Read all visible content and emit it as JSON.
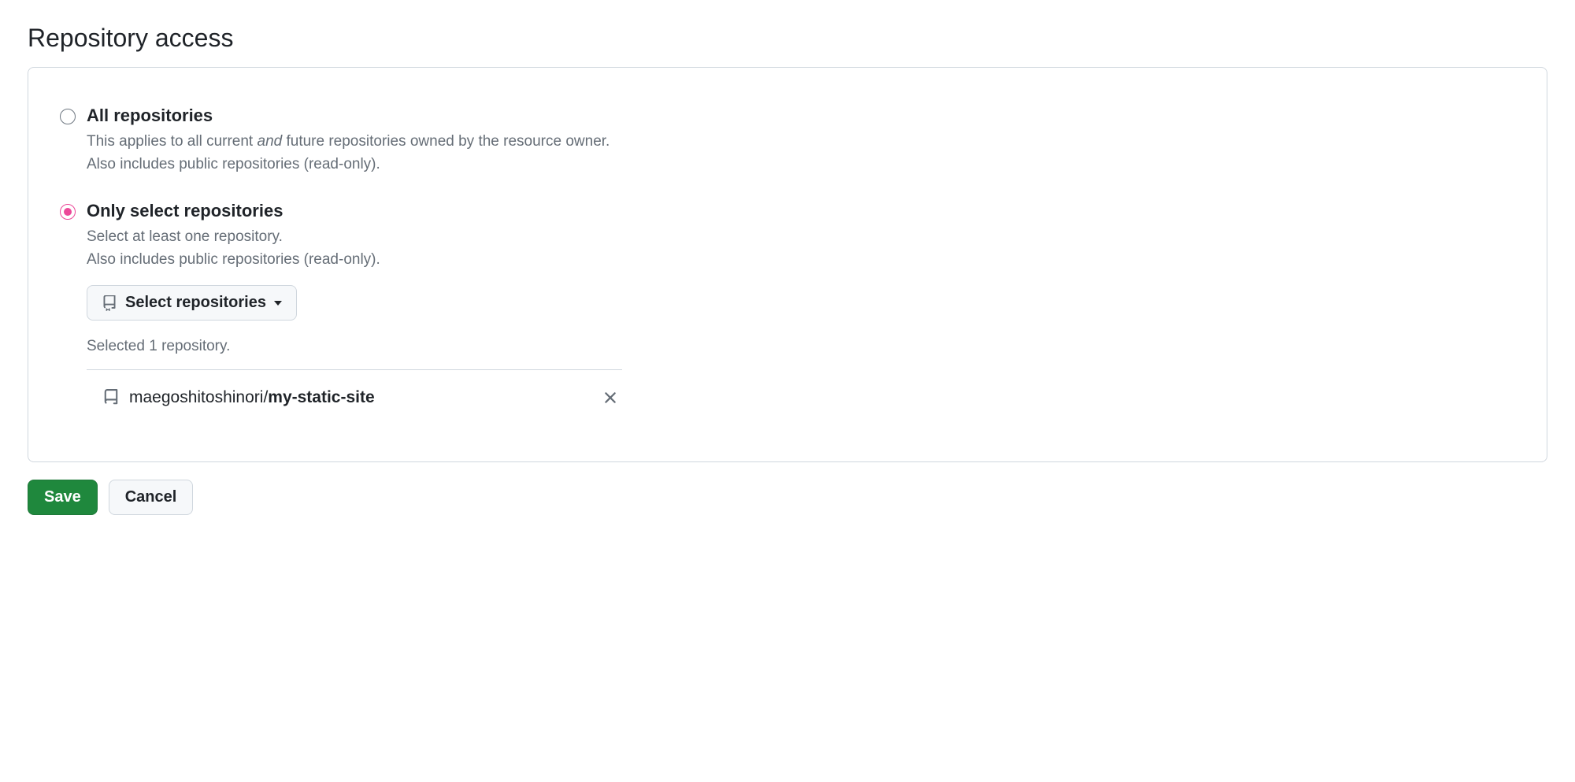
{
  "section": {
    "title": "Repository access"
  },
  "options": {
    "all": {
      "label": "All repositories",
      "desc_prefix": "This applies to all current ",
      "desc_em": "and",
      "desc_suffix": " future repositories owned by the resource owner.",
      "desc_line2": "Also includes public repositories (read-only).",
      "selected": false
    },
    "select": {
      "label": "Only select repositories",
      "desc_line1": "Select at least one repository.",
      "desc_line2": "Also includes public repositories (read-only).",
      "selected": true,
      "picker_label": "Select repositories",
      "summary": "Selected 1 repository.",
      "items": [
        {
          "owner": "maegoshitoshinori",
          "separator": "/",
          "name": "my-static-site"
        }
      ]
    }
  },
  "actions": {
    "save": "Save",
    "cancel": "Cancel"
  }
}
